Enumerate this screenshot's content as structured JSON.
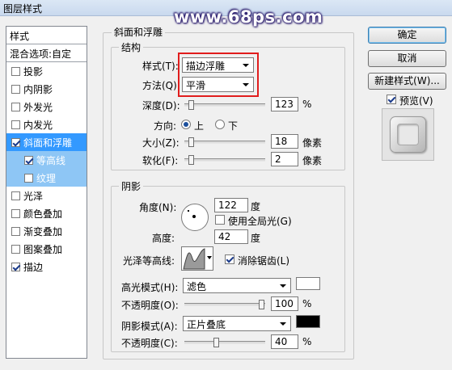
{
  "window": {
    "title": "图层样式",
    "watermark": "www.68ps.com"
  },
  "styles": {
    "header": "样式",
    "blending": "混合选项:自定",
    "items": [
      {
        "label": "投影",
        "checked": false
      },
      {
        "label": "内阴影",
        "checked": false
      },
      {
        "label": "外发光",
        "checked": false
      },
      {
        "label": "内发光",
        "checked": false
      },
      {
        "label": "斜面和浮雕",
        "checked": true
      },
      {
        "label": "等高线",
        "checked": true
      },
      {
        "label": "纹理",
        "checked": false
      },
      {
        "label": "光泽",
        "checked": false
      },
      {
        "label": "颜色叠加",
        "checked": false
      },
      {
        "label": "渐变叠加",
        "checked": false
      },
      {
        "label": "图案叠加",
        "checked": false
      },
      {
        "label": "描边",
        "checked": true
      }
    ]
  },
  "bevel": {
    "section_title": "斜面和浮雕",
    "structure_title": "结构",
    "style_label": "样式(T):",
    "style_value": "描边浮雕",
    "technique_label": "方法(Q):",
    "technique_value": "平滑",
    "depth_label": "深度(D):",
    "depth_value": "123",
    "depth_unit": "%",
    "direction_label": "方向:",
    "direction_up": "上",
    "direction_down": "下",
    "size_label": "大小(Z):",
    "size_value": "18",
    "size_unit": "像素",
    "soften_label": "软化(F):",
    "soften_value": "2",
    "soften_unit": "像素"
  },
  "shading": {
    "title": "阴影",
    "angle_label": "角度(N):",
    "angle_value": "122",
    "angle_unit": "度",
    "global_light_label": "使用全局光(G)",
    "altitude_label": "高度:",
    "altitude_value": "42",
    "altitude_unit": "度",
    "gloss_label": "光泽等高线:",
    "antialias_label": "消除锯齿(L)",
    "highlight_label": "高光模式(H):",
    "highlight_value": "滤色",
    "highlight_color": "#ffffff",
    "highlight_opacity_label": "不透明度(O):",
    "highlight_opacity_value": "100",
    "highlight_opacity_unit": "%",
    "shadow_label": "阴影模式(A):",
    "shadow_value": "正片叠底",
    "shadow_color": "#000000",
    "shadow_opacity_label": "不透明度(C):",
    "shadow_opacity_value": "40",
    "shadow_opacity_unit": "%"
  },
  "buttons": {
    "ok": "确定",
    "cancel": "取消",
    "new_style": "新建样式(W)...",
    "preview": "预览(V)"
  }
}
